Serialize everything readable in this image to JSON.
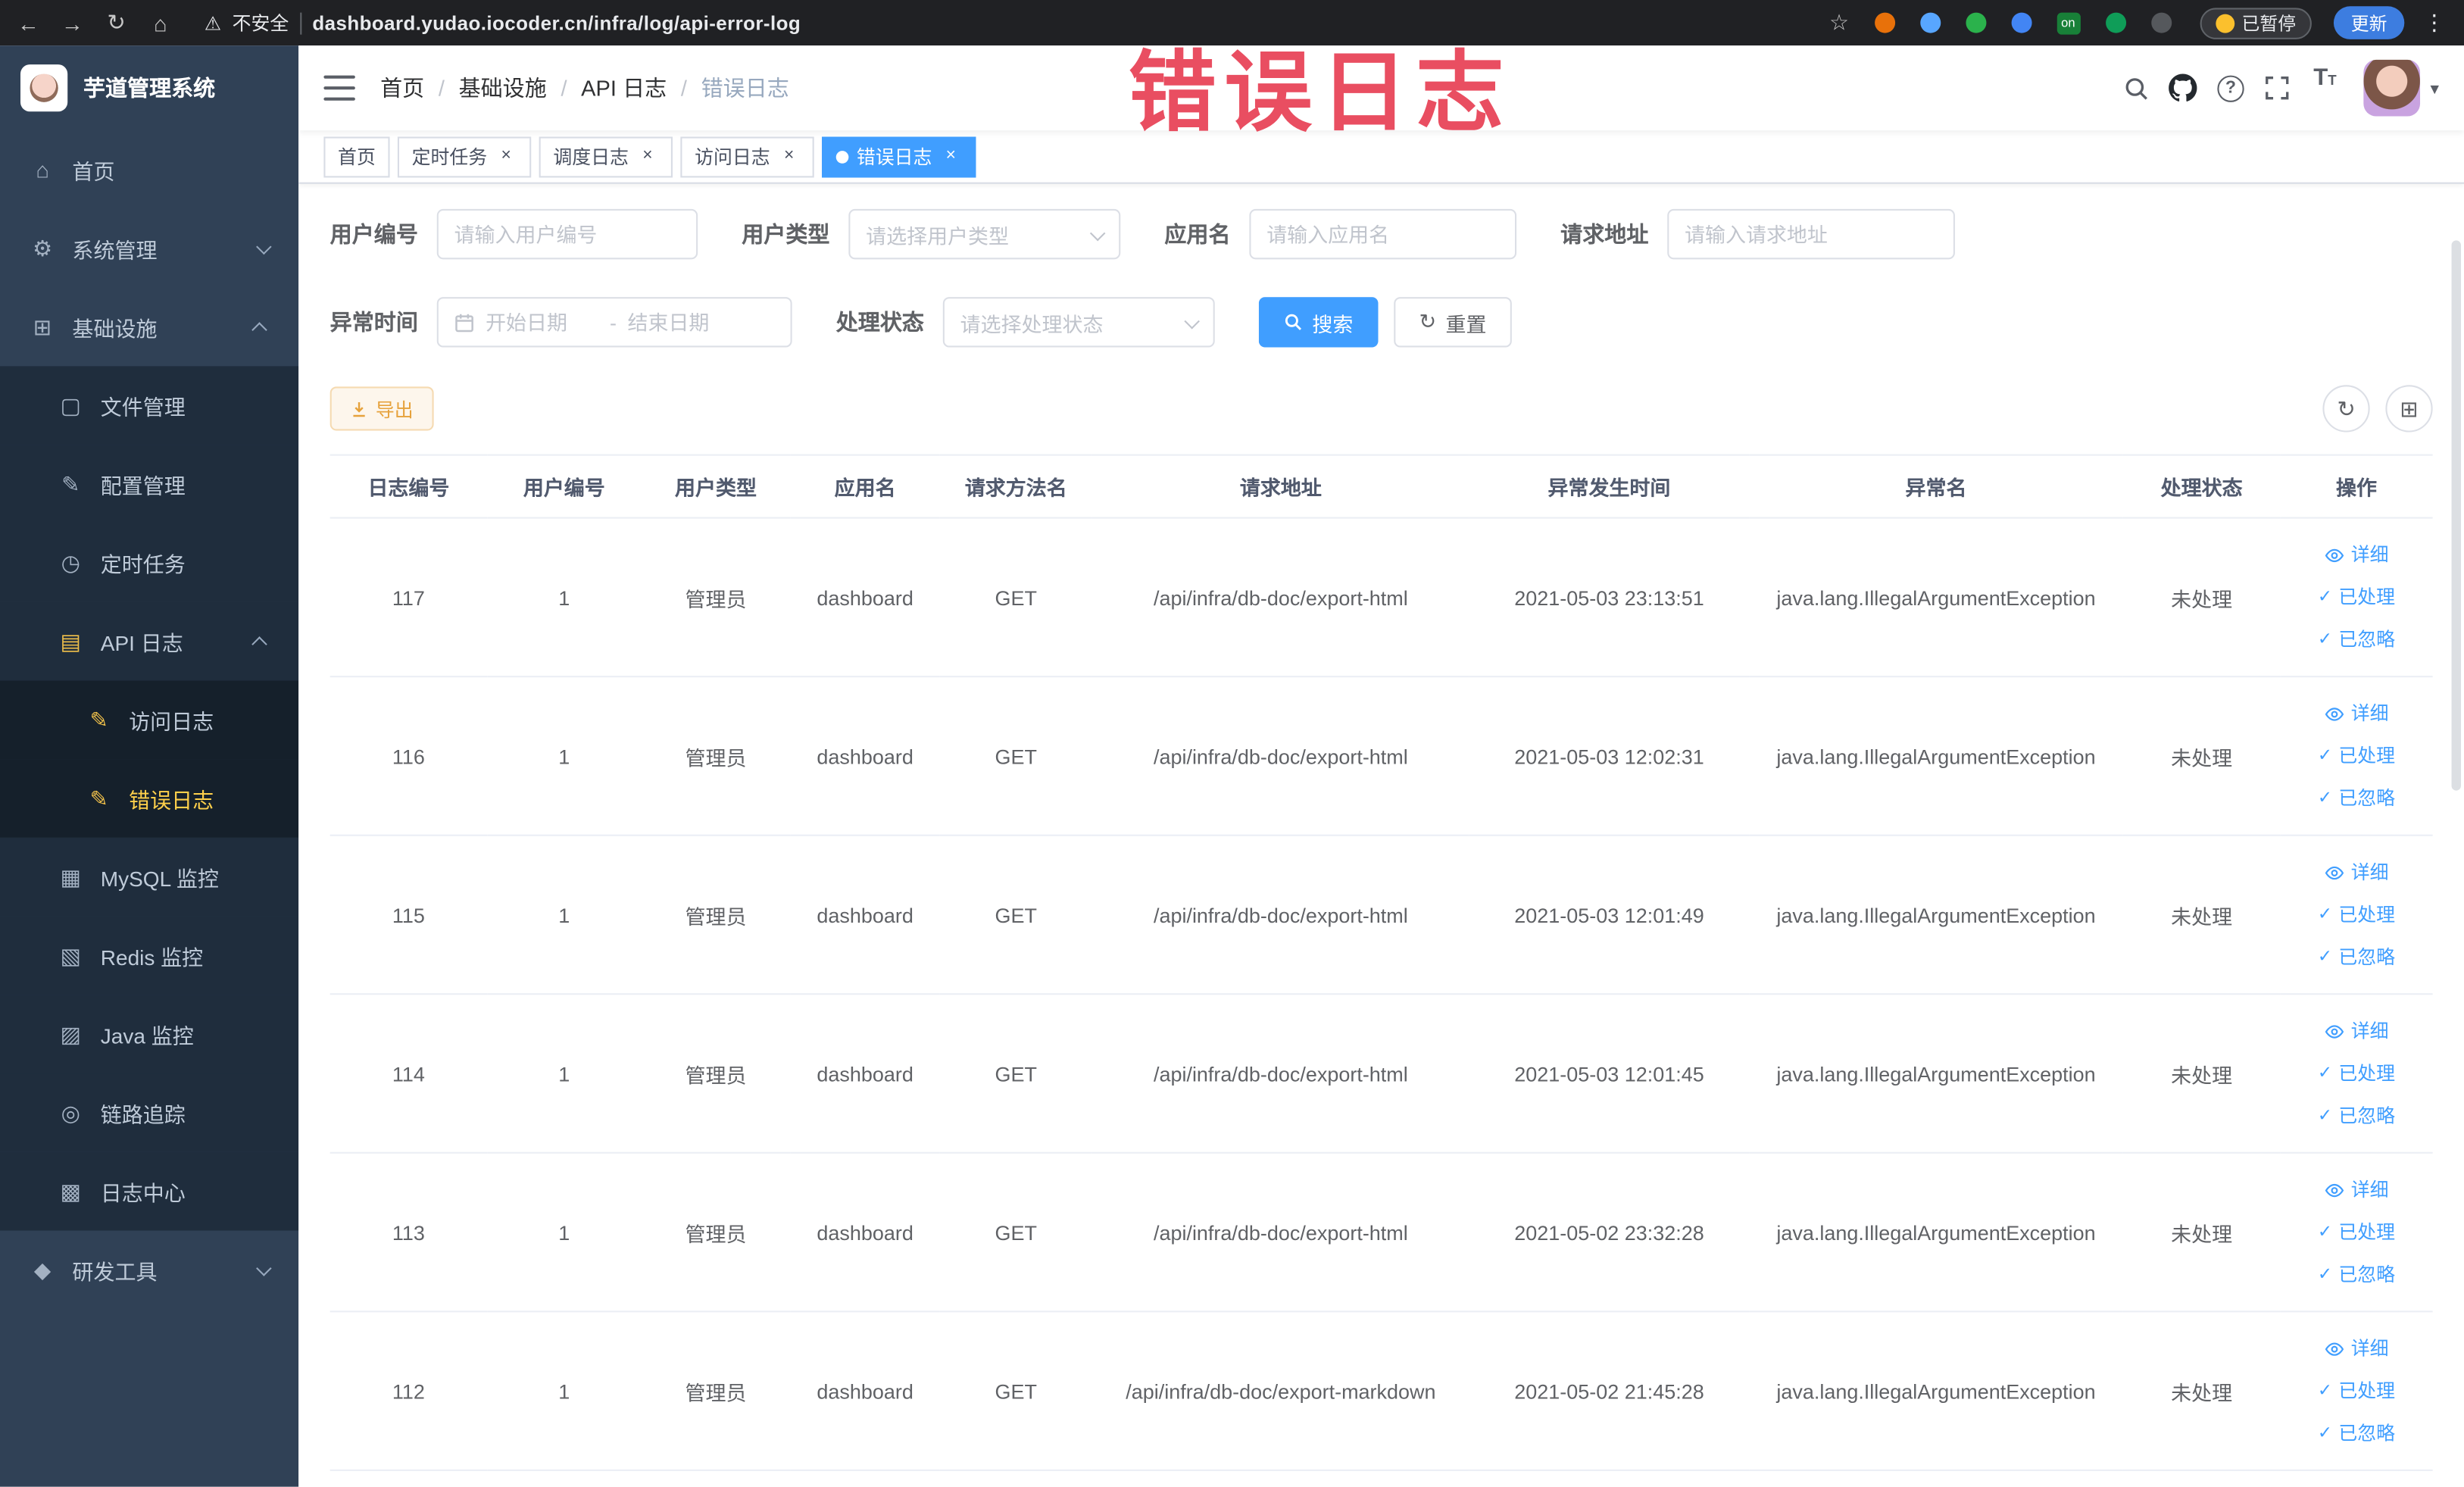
{
  "browser": {
    "security_label": "不安全",
    "url": "dashboard.yudao.iocoder.cn/infra/log/api-error-log",
    "extension_badge": "on",
    "paused_badge": "已暂停",
    "update_button": "更新",
    "extension_colors": [
      "#e8710a",
      "#58a6ff",
      "#2bb24c",
      "#4285f4",
      "#0f9d58",
      "#55585c"
    ]
  },
  "icons": {
    "back": "←",
    "forward": "→",
    "reload": "↻",
    "home": "⌂",
    "warning": "⚠",
    "star": "☆",
    "kebab": "⋮",
    "caret_down": "▾",
    "check": "✓",
    "close": "×",
    "question": "?",
    "font_size_large": "T",
    "font_size_small": "T",
    "sidebar_home": "⌂",
    "sidebar_system": "⚙",
    "sidebar_infra": "⊞",
    "sidebar_file": "▢",
    "sidebar_config": "✎",
    "sidebar_job": "◷",
    "sidebar_api_log": "▤",
    "sidebar_access_log": "✎",
    "sidebar_error_log": "✎",
    "sidebar_mysql": "▦",
    "sidebar_redis": "▧",
    "sidebar_java": "▨",
    "sidebar_trace": "◎",
    "sidebar_log_center": "▩",
    "sidebar_dev_tools": "◆",
    "refresh": "↻",
    "grid": "⊞"
  },
  "sidebar": {
    "logo_title": "芋道管理系统",
    "items": {
      "home": "首页",
      "system": "系统管理",
      "infra": "基础设施",
      "file": "文件管理",
      "config": "配置管理",
      "job": "定时任务",
      "api_log": "API 日志",
      "access_log": "访问日志",
      "error_log": "错误日志",
      "mysql": "MySQL 监控",
      "redis": "Redis 监控",
      "java": "Java 监控",
      "trace": "链路追踪",
      "log_center": "日志中心",
      "dev_tools": "研发工具"
    }
  },
  "header": {
    "separator": "/",
    "breadcrumb": [
      "首页",
      "基础设施",
      "API 日志",
      "错误日志"
    ]
  },
  "watermark": "错误日志",
  "tabs": [
    {
      "label": "首页"
    },
    {
      "label": "定时任务"
    },
    {
      "label": "调度日志"
    },
    {
      "label": "访问日志"
    },
    {
      "label": "错误日志"
    }
  ],
  "filters": {
    "user_id": {
      "label": "用户编号",
      "placeholder": "请输入用户编号",
      "value": ""
    },
    "user_type": {
      "label": "用户类型",
      "placeholder": "请选择用户类型"
    },
    "app_name": {
      "label": "应用名",
      "placeholder": "请输入应用名",
      "value": ""
    },
    "request_url": {
      "label": "请求地址",
      "placeholder": "请输入请求地址",
      "value": ""
    },
    "exception_time": {
      "label": "异常时间",
      "start_placeholder": "开始日期",
      "separator": "-",
      "end_placeholder": "结束日期"
    },
    "process_status": {
      "label": "处理状态",
      "placeholder": "请选择处理状态"
    },
    "search_button": "搜索",
    "reset_button": "重置"
  },
  "toolbar": {
    "export_button": "导出"
  },
  "table": {
    "columns": [
      "日志编号",
      "用户编号",
      "用户类型",
      "应用名",
      "请求方法名",
      "请求地址",
      "异常发生时间",
      "异常名",
      "处理状态",
      "操作"
    ],
    "action_labels": {
      "detail": "详细",
      "processed": "已处理",
      "ignored": "已忽略"
    },
    "rows": [
      {
        "log_id": "117",
        "user_id": "1",
        "user_type": "管理员",
        "app_name": "dashboard",
        "method": "GET",
        "url": "/api/infra/db-doc/export-html",
        "time": "2021-05-03 23:13:51",
        "exception": "java.lang.IllegalArgumentException",
        "status": "未处理"
      },
      {
        "log_id": "116",
        "user_id": "1",
        "user_type": "管理员",
        "app_name": "dashboard",
        "method": "GET",
        "url": "/api/infra/db-doc/export-html",
        "time": "2021-05-03 12:02:31",
        "exception": "java.lang.IllegalArgumentException",
        "status": "未处理"
      },
      {
        "log_id": "115",
        "user_id": "1",
        "user_type": "管理员",
        "app_name": "dashboard",
        "method": "GET",
        "url": "/api/infra/db-doc/export-html",
        "time": "2021-05-03 12:01:49",
        "exception": "java.lang.IllegalArgumentException",
        "status": "未处理"
      },
      {
        "log_id": "114",
        "user_id": "1",
        "user_type": "管理员",
        "app_name": "dashboard",
        "method": "GET",
        "url": "/api/infra/db-doc/export-html",
        "time": "2021-05-03 12:01:45",
        "exception": "java.lang.IllegalArgumentException",
        "status": "未处理"
      },
      {
        "log_id": "113",
        "user_id": "1",
        "user_type": "管理员",
        "app_name": "dashboard",
        "method": "GET",
        "url": "/api/infra/db-doc/export-html",
        "time": "2021-05-02 23:32:28",
        "exception": "java.lang.IllegalArgumentException",
        "status": "未处理"
      },
      {
        "log_id": "112",
        "user_id": "1",
        "user_type": "管理员",
        "app_name": "dashboard",
        "method": "GET",
        "url": "/api/infra/db-doc/export-markdown",
        "time": "2021-05-02 21:45:28",
        "exception": "java.lang.IllegalArgumentException",
        "status": "未处理"
      }
    ]
  },
  "colors": {
    "primary": "#409eff",
    "sidebar_bg": "#304156",
    "active_menu_text": "#ffd04b",
    "watermark_red": "#e84054",
    "warning_button": "#e6a23c"
  }
}
